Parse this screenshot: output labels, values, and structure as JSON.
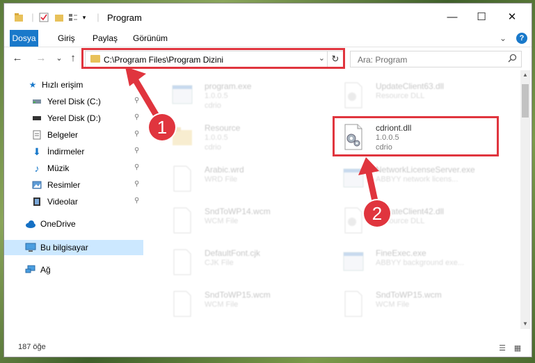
{
  "window": {
    "title": "Program",
    "controls": {
      "minimize": "—",
      "maximize": "☐",
      "close": "✕"
    }
  },
  "ribbon": {
    "tabs": [
      "Dosya",
      "Giriş",
      "Paylaş",
      "Görünüm"
    ],
    "expand": "⌄",
    "help": "?"
  },
  "navigation": {
    "back": "←",
    "forward": "→",
    "recent": "⌄",
    "up": "↑",
    "address": "C:\\Program Files\\Program Dizini",
    "address_dropdown": "⌄",
    "refresh": "↻",
    "search_placeholder": "Ara: Program"
  },
  "sidebar": {
    "items": [
      {
        "label": "Hızlı erişim",
        "icon": "star-icon",
        "pinned": false
      },
      {
        "label": "Yerel Disk (C:)",
        "icon": "drive-icon",
        "pinned": true
      },
      {
        "label": "Yerel Disk (D:)",
        "icon": "drive-icon",
        "pinned": true
      },
      {
        "label": "Belgeler",
        "icon": "documents-icon",
        "pinned": true
      },
      {
        "label": "İndirmeler",
        "icon": "download-icon",
        "pinned": true
      },
      {
        "label": "Müzik",
        "icon": "music-icon",
        "pinned": true
      },
      {
        "label": "Resimler",
        "icon": "pictures-icon",
        "pinned": true
      },
      {
        "label": "Videolar",
        "icon": "video-icon",
        "pinned": true
      },
      {
        "label": "OneDrive",
        "icon": "cloud-icon",
        "pinned": false
      },
      {
        "label": "Bu bilgisayar",
        "icon": "computer-icon",
        "pinned": false,
        "selected": true
      },
      {
        "label": "Ağ",
        "icon": "network-icon",
        "pinned": false
      }
    ],
    "pin_glyph": "📌"
  },
  "files": [
    {
      "name": "program.exe",
      "line2": "1.0.0.5",
      "line3": "cdrio",
      "icon": "exe-icon",
      "faded": true
    },
    {
      "name": "UpdateClient63.dll",
      "line2": "Resource DLL",
      "line3": "",
      "icon": "dll-icon",
      "faded": true
    },
    {
      "name": "Resource",
      "line2": "1.0.0.5",
      "line3": "cdrio",
      "icon": "folder-icon",
      "faded": true
    },
    {
      "name": "cdriont.dll",
      "line2": "1.0.0.5",
      "line3": "cdrio",
      "icon": "dll-icon",
      "faded": false
    },
    {
      "name": "Arabic.wrd",
      "line2": "WRD File",
      "line3": "",
      "icon": "file-icon",
      "faded": true
    },
    {
      "name": "NetworkLicenseServer.exe",
      "line2": "ABBYY network licens...",
      "line3": "",
      "icon": "exe-icon",
      "faded": true
    },
    {
      "name": "SndToWP14.wcm",
      "line2": "WCM File",
      "line3": "",
      "icon": "file-icon",
      "faded": true
    },
    {
      "name": "UpdateClient42.dll",
      "line2": "Resource DLL",
      "line3": "",
      "icon": "dll-icon",
      "faded": true
    },
    {
      "name": "DefaultFont.cjk",
      "line2": "CJK File",
      "line3": "",
      "icon": "file-icon",
      "faded": true
    },
    {
      "name": "FineExec.exe",
      "line2": "ABBYY background exe...",
      "line3": "",
      "icon": "exe-icon",
      "faded": true
    },
    {
      "name": "SndToWP15.wcm",
      "line2": "WCM File",
      "line3": "",
      "icon": "file-icon",
      "faded": true
    },
    {
      "name": "SndToWP15.wcm",
      "line2": "WCM File",
      "line3": "",
      "icon": "file-icon",
      "faded": true
    }
  ],
  "status": {
    "count_text": "187 öğe"
  },
  "annotations": {
    "callout_1": "1",
    "callout_2": "2",
    "color": "#e0353e"
  },
  "colors": {
    "accent": "#1979ca",
    "selection": "#cce8ff",
    "folder": "#e8c15a"
  }
}
